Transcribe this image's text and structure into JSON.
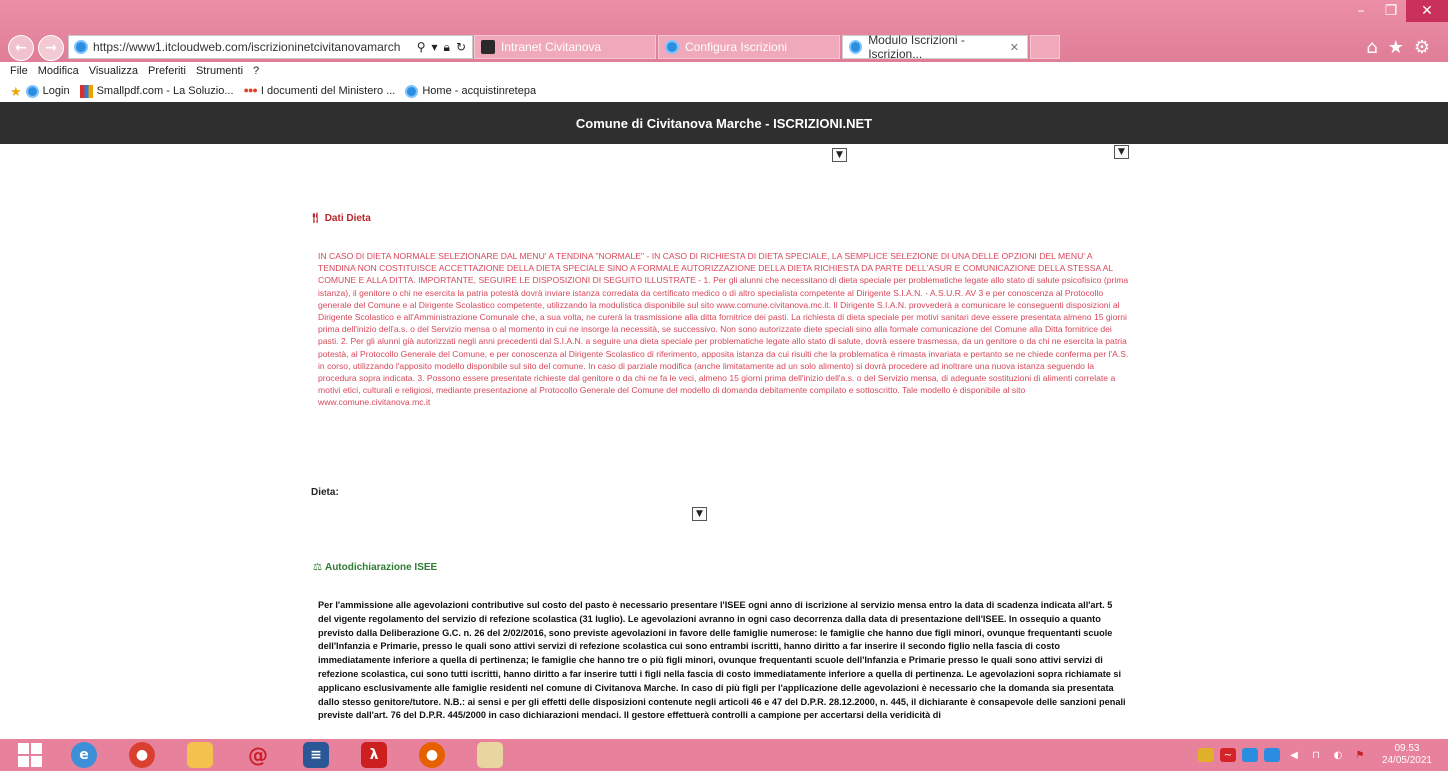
{
  "browser": {
    "url": "https://www1.itcloudweb.com/iscrizioninetcivitanovamarch",
    "tabs": [
      {
        "label": "Intranet Civitanova"
      },
      {
        "label": "Configura Iscrizioni"
      },
      {
        "label": "Modulo Iscrizioni - Iscrizion..."
      }
    ],
    "menu": [
      "File",
      "Modifica",
      "Visualizza",
      "Preferiti",
      "Strumenti",
      "?"
    ],
    "favorites": [
      {
        "label": "Login",
        "icon": "ie-icon"
      },
      {
        "label": "Smallpdf.com - La Soluzio...",
        "icon": "smallpdf-icon"
      },
      {
        "label": "I documenti del Ministero ...",
        "icon": "ministero-icon"
      },
      {
        "label": "Home - acquistinretepa",
        "icon": "ie-icon"
      }
    ]
  },
  "header": {
    "title": "Comune di Civitanova Marche - ISCRIZIONI.NET"
  },
  "dieta": {
    "section_title": "Dati Dieta",
    "note": "IN CASO DI DIETA NORMALE SELEZIONARE DAL MENU' A TENDINA \"NORMALE\" - IN CASO DI RICHIESTA DI DIETA SPECIALE, LA SEMPLICE SELEZIONE DI UNA DELLE OPZIONI DEL MENU' A TENDINA NON COSTITUISCE ACCETTAZIONE DELLA DIETA SPECIALE SINO A FORMALE AUTORIZZAZIONE DELLA DIETA RICHIESTA DA PARTE DELL'ASUR E COMUNICAZIONE DELLA STESSA AL COMUNE E ALLA DITTA. IMPORTANTE, SEGUIRE LE DISPOSIZIONI DI SEGUITO ILLUSTRATE - 1. Per gli alunni che necessitano di dieta speciale per problematiche legate allo stato di salute psicofisico (prima istanza), il genitore o chi ne esercita la patria potestà dovrà inviare istanza corredata da certificato medico o di altro specialista competente al Dirigente S.I.A.N. - A.S.U.R. AV 3 e per conoscenza al Protocollo generale del Comune e al Dirigente Scolastico competente, utilizzando la modulistica disponibile sul sito www.comune.civitanova.mc.it. Il Dirigente S.I.A.N. provvederà a comunicare le conseguenti disposizioni al Dirigente Scolastico e all'Amministrazione Comunale che, a sua volta, ne curerà la trasmissione alla ditta fornitrice dei pasti. La richiesta di dieta speciale per motivi sanitari deve essere presentata almeno 15 giorni prima dell'inizio dell'a.s. o del Servizio mensa o al momento in cui ne insorge la necessità, se successivo. Non sono autorizzate diete speciali sino alla formale comunicazione del Comune alla Ditta fornitrice dei pasti. 2. Per gli alunni già autorizzati negli anni precedenti dal S.I.A.N. a seguire una dieta speciale per problematiche legate allo stato di salute, dovrà essere trasmessa, da un genitore o da chi ne esercita la patria potestà, al Protocollo Generale del Comune, e per conoscenza al Dirigente Scolastico di riferimento, apposita istanza da cui risulti che la problematica è rimasta invariata e pertanto se ne chiede conferma per l'A.S. in corso, utilizzando l'apposito modello disponibile sul sito del comune. In caso di parziale modifica (anche limitatamente ad un solo alimento) si dovrà procedere ad inoltrare una nuova istanza seguendo la procedura sopra indicata. 3. Possono essere presentate richieste dal genitore o da chi ne fa le veci, almeno 15 giorni prima dell'inizio dell'a.s. o del Servizio mensa, di adeguate sostituzioni di alimenti correlate a motivi etici, culturali e religiosi, mediante presentazione al Protocollo Generale del Comune del modello di domanda debitamente compilato e sottoscritto. Tale modello è disponibile al sito www.comune.civitanova.mc.it",
    "field_label": "Dieta:"
  },
  "isee": {
    "section_title": "Autodichiarazione ISEE",
    "note": "Per l'ammissione alle agevolazioni contributive sul costo del pasto è necessario presentare l'ISEE ogni anno di iscrizione al servizio mensa entro la data di scadenza indicata all'art. 5 del vigente regolamento del servizio di refezione scolastica (31 luglio). Le agevolazioni avranno in ogni caso decorrenza dalla data di presentazione dell'ISEE. In ossequio a quanto previsto dalla Deliberazione G.C. n. 26 del 2/02/2016, sono previste agevolazioni in favore delle famiglie numerose: le famiglie che hanno due figli minori, ovunque frequentanti scuole dell'Infanzia e Primarie, presso le quali sono attivi servizi di refezione scolastica cui sono entrambi iscritti, hanno diritto a far inserire il secondo figlio nella fascia di costo immediatamente inferiore a quella di pertinenza; le famiglie che hanno tre o più figli minori, ovunque frequentanti scuole dell'Infanzia e Primarie presso le quali sono attivi servizi di refezione scolastica, cui sono tutti iscritti, hanno diritto a far inserire tutti i figli nella fascia di costo immediatamente inferiore a quella di pertinenza. Le agevolazioni sopra richiamate si applicano esclusivamente alle famiglie residenti nel comune di Civitanova Marche. In caso di più figli per l'applicazione delle agevolazioni è necessario che la domanda sia presentata dallo stesso genitore/tutore. N.B.: ai sensi e per gli effetti delle disposizioni contenute negli articoli 46 e 47 del D.P.R. 28.12.2000, n. 445, il dichiarante è consapevole delle sanzioni penali previste dall'art. 76 del D.P.R. 445/2000 in caso dichiarazioni mendaci. Il gestore effettuerà controlli a campione per accertarsi della veridicità di"
  },
  "taskbar": {
    "time": "09.53",
    "date": "24/05/2021"
  },
  "colors": {
    "chrome_pink": "#e8829c",
    "header_dark": "#2f2f2f",
    "dieta_red": "#d9485a",
    "isee_green": "#2e7d32"
  }
}
